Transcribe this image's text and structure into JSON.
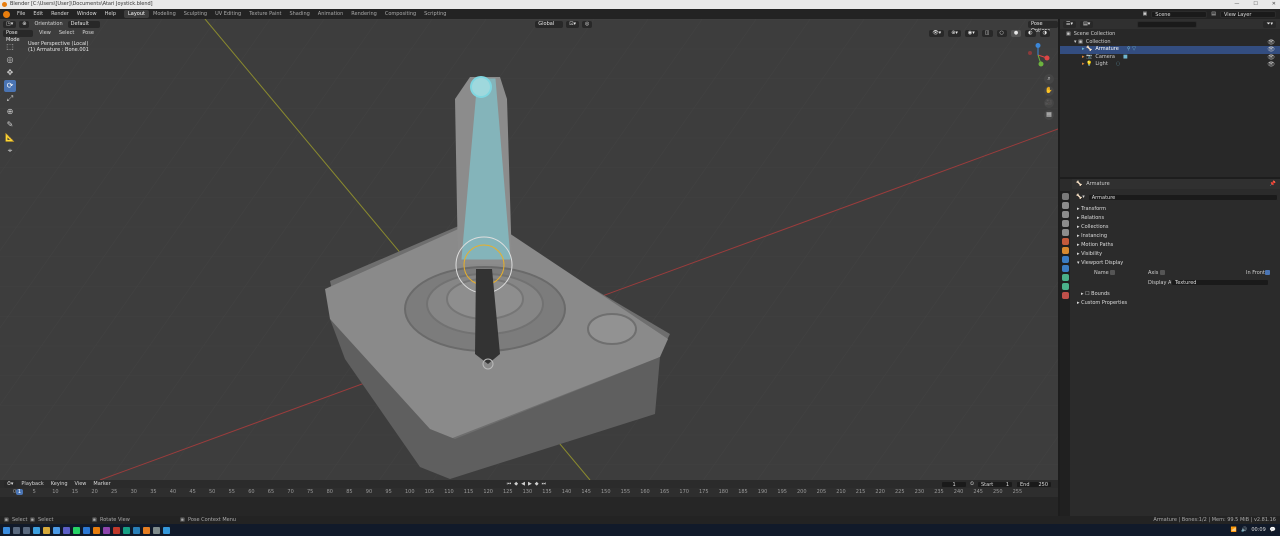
{
  "window": {
    "title": "Blender [C:\\Users\\[User]\\Documents\\Atari Joystick.blend]",
    "controls": [
      "—",
      "☐",
      "✕"
    ]
  },
  "menu": [
    "File",
    "Edit",
    "Render",
    "Window",
    "Help"
  ],
  "workspaces": [
    "Layout",
    "Modeling",
    "Sculpting",
    "UV Editing",
    "Texture Paint",
    "Shading",
    "Animation",
    "Rendering",
    "Compositing",
    "Scripting"
  ],
  "active_workspace": "Layout",
  "scene_field": "Scene",
  "view_layer_field": "View Layer",
  "viewport": {
    "orientation_label": "Orientation",
    "orientation_value": "Default",
    "transform_space": "Global",
    "mode": "Pose Mode",
    "menus": [
      "View",
      "Select",
      "Pose"
    ],
    "pose_options": "Pose Options",
    "info_line1": "User Perspective (Local)",
    "info_line2": "(1) Armature : Bone.001"
  },
  "outliner": {
    "search_placeholder": "",
    "rows": [
      {
        "label": "Scene Collection",
        "indent": 0
      },
      {
        "label": "Collection",
        "indent": 1
      },
      {
        "label": "Armature",
        "indent": 2,
        "selected": true
      },
      {
        "label": "Camera",
        "indent": 2
      },
      {
        "label": "Light",
        "indent": 2
      }
    ]
  },
  "properties": {
    "object_name": "Armature",
    "data_name": "Armature",
    "panels": [
      "Transform",
      "Relations",
      "Collections",
      "Instancing",
      "Motion Paths",
      "Visibility",
      "Viewport Display"
    ],
    "viewport_display": {
      "name_label": "Name",
      "axis_label": "Axis",
      "in_front_label": "In Front",
      "display_as_label": "Display As",
      "display_as_value": "Textured",
      "bounds_label": "Bounds"
    },
    "custom_properties": "Custom Properties"
  },
  "timeline": {
    "menus": [
      "Playback",
      "Keying",
      "View",
      "Marker"
    ],
    "current_frame": "1",
    "start_label": "Start",
    "start": "1",
    "end_label": "End",
    "end": "250",
    "ticks": [
      "0",
      "5",
      "10",
      "15",
      "20",
      "25",
      "30",
      "35",
      "40",
      "45",
      "50",
      "55",
      "60",
      "65",
      "70",
      "75",
      "80",
      "85",
      "90",
      "95",
      "100",
      "105",
      "110",
      "115",
      "120",
      "125",
      "130",
      "135",
      "140",
      "145",
      "150",
      "155",
      "160",
      "165",
      "170",
      "175",
      "180",
      "185",
      "190",
      "195",
      "200",
      "205",
      "210",
      "215",
      "220",
      "225",
      "230",
      "235",
      "240",
      "245",
      "250",
      "255"
    ]
  },
  "status": {
    "select": "Select",
    "rotate": "Rotate View",
    "context": "Pose Context Menu",
    "right": "Armature | Bones:1/2 | Mem: 99.5 MiB | v2.81.16"
  },
  "taskbar": {
    "time": "00:09"
  },
  "colors": {
    "accent": "#4a74b3",
    "selection": "#334d80",
    "bone": "#7fd6e0",
    "orange": "#e87d0d"
  }
}
